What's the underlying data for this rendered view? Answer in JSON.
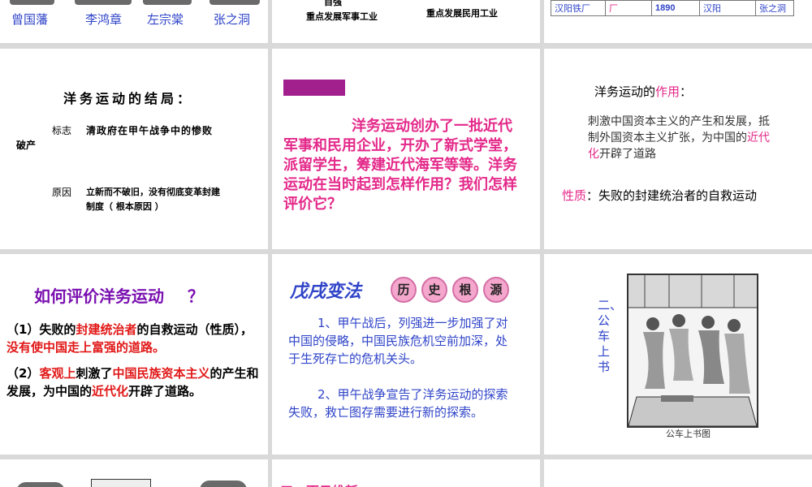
{
  "slide1": {
    "names": [
      "曾国藩",
      "李鸿章",
      "左宗棠",
      "张之洞"
    ]
  },
  "slide2": {
    "top": "自强",
    "left": "重点发展军事工业",
    "right": "重点发展民用工业"
  },
  "slide3": {
    "row": [
      "汉阳铁厂",
      "厂",
      "1890",
      "汉阳",
      "张之洞"
    ]
  },
  "slide4": {
    "title": "洋务运动的结局：",
    "sign_label": "标志",
    "sign_text": "清政府在甲午战争中的惨败",
    "sign_tail": "破产",
    "reason_label": "原因",
    "reason_text": "立新而不破旧，没有彻底变革封建",
    "reason_text2": "制度（ 根本原因 ）"
  },
  "slide5": {
    "text": "洋务运动创办了一批近代军事和民用企业，开办了新式学堂，派留学生，筹建近代海军等等。洋务运动在当时起到怎样作用？我们怎样评价它？"
  },
  "slide6": {
    "title_pre": "洋务运动的",
    "title_hl": "作用",
    "title_post": "：",
    "body_1": "刺激中国资本主义的产生和发展，抵制外国资本主义扩张，为中国的",
    "body_hl": "近代化",
    "body_2": "开辟了道路",
    "nature_label": "性质",
    "nature_text": "：失败的封建统治者的自救运动"
  },
  "slide7": {
    "title": "如何评价洋务运动",
    "qmark": "？",
    "p1_a": "（1）失败的",
    "p1_b": "封建统治者",
    "p1_c": "的自救运动（性质），",
    "p1_d": "没有使中国走上富强的道路。",
    "p2_a": "（2）",
    "p2_b": "客观上",
    "p2_c": "刺激了",
    "p2_d": "中国民族资本主义",
    "p2_e": "的产生和发展，为中国的",
    "p2_f": "近代化",
    "p2_g": "开辟了道路。"
  },
  "slide8": {
    "title": "戊戌变法",
    "badges": [
      "历",
      "史",
      "根",
      "源"
    ],
    "p1": "1、甲午战后，列强进一步加强了对中国的侵略，中国民族危机空前加深，处于生死存亡的危机关头。",
    "p2": "2、甲午战争宣告了洋务运动的探索失败，救亡图存需要进行新的探索。"
  },
  "slide9": {
    "vertical": "二、公车上书",
    "caption": "公车上书图"
  },
  "slide11": {
    "heading": "三、百日维新"
  },
  "colors": {
    "magenta": "#e4298a",
    "blue": "#2f44c8",
    "red": "#e11818",
    "purple": "#7a10b0"
  }
}
